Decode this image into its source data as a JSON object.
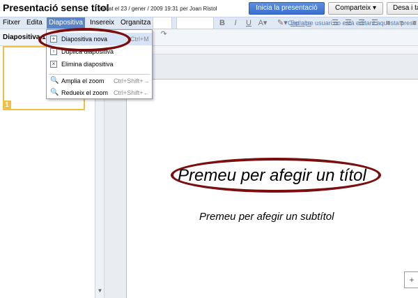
{
  "header": {
    "doc_title": "Presentació sense títol",
    "edit_info": "editat el 23 / gener / 2009 19:31 per Joan Ristol",
    "start_button": "Inicia la presentació",
    "share_button": "Comparteix ▾",
    "save_button": "Desa i ta"
  },
  "menubar": {
    "items": [
      "Fitxer",
      "Edita",
      "Diapositiva",
      "Insereix",
      "Organitza"
    ],
    "note": "Cap altre usuari no està editant aquesta prese"
  },
  "toolbar": {
    "slide_label": "Diapositiva 1",
    "link_label": "Enllaça"
  },
  "dropdown": {
    "items": [
      {
        "label": "Diapositiva nova",
        "shortcut": "Ctrl+M",
        "icon": "new-slide-icon"
      },
      {
        "label": "Duplica diapositiva",
        "shortcut": "",
        "icon": "duplicate-slide-icon"
      },
      {
        "label": "Elimina diapositiva",
        "shortcut": "",
        "icon": "delete-slide-icon"
      },
      {
        "label": "Amplia el zoom",
        "shortcut": "Ctrl+Shift+→",
        "icon": "zoom-in-icon"
      },
      {
        "label": "Redueix el zoom",
        "shortcut": "Ctrl+Shift+←",
        "icon": "zoom-out-icon"
      }
    ]
  },
  "slide_panel": {
    "thumbnail_number": "1"
  },
  "slide": {
    "title_placeholder": "Premeu per afegir un títol",
    "subtitle_placeholder": "Premeu per afegir un subtítol"
  },
  "colors": {
    "accent": "#3a6fcf",
    "annotation": "#7a0d0d",
    "thumb_border": "#f0c040"
  }
}
